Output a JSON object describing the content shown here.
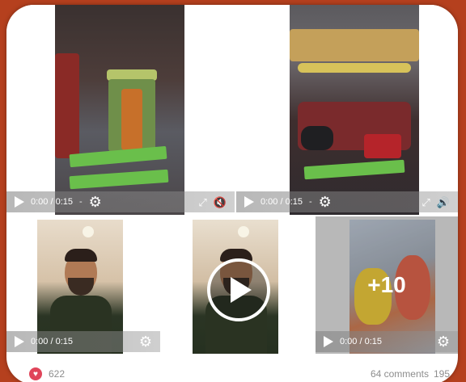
{
  "videos": [
    {
      "time": "0:00 / 0:15",
      "dash": "-"
    },
    {
      "time": "0:00 / 0:15",
      "dash": "-"
    },
    {
      "time": "0:00 / 0:15"
    },
    {
      "time": "0:00 / 0:15"
    },
    {
      "time": "0:00 / 0:15"
    }
  ],
  "more_count": "+10",
  "footer": {
    "reactions": "622",
    "comments": "64 comments",
    "shares": "195"
  },
  "colors": {
    "background": "#b5401e",
    "card": "#ffffff",
    "reaction": "#e0455a"
  },
  "icons": [
    "play-icon",
    "gear-icon",
    "expand-icon",
    "speaker-icon",
    "big-play-icon",
    "heart-reaction-icon"
  ]
}
